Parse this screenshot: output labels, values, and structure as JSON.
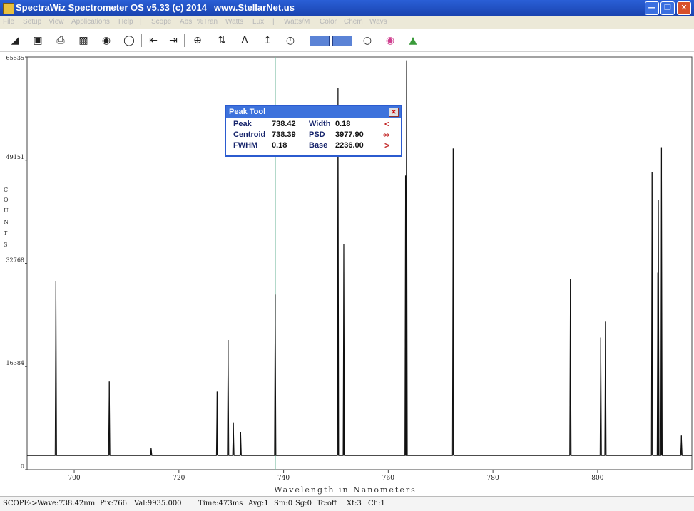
{
  "window": {
    "title": "SpectraWiz  Spectrometer OS v5.33 (c) 2014",
    "url": "www.StellarNet.us",
    "buttons": [
      "minimize-button",
      "restore-button",
      "close-button"
    ]
  },
  "menu": [
    "File",
    "Setup",
    "View",
    "Applications",
    "Help",
    "|",
    "Scope",
    "Abs",
    "%Tran",
    "Watts",
    "Lux",
    "|",
    "Watts/M",
    "Color",
    "Chem",
    "Wavs"
  ],
  "toolbar": {
    "icons": [
      "open-icon",
      "save-icon",
      "print-icon",
      "camera-icon",
      "bulb-dark-icon",
      "bulb-light-icon",
      "left-cursor-icon",
      "right-cursor-icon",
      "zoom-icon",
      "autoscale-y-icon",
      "peak-icon",
      "peak-up-icon",
      "timer-icon",
      "dark-store-icon",
      "reference-store-icon",
      "lamp-icon",
      "color-wheel-icon",
      "rgb-icon"
    ]
  },
  "peak_tool": {
    "title": "Peak Tool",
    "peak_label": "Peak",
    "peak": "738.42",
    "width_label": "Width",
    "width": "0.18",
    "centroid_label": "Centroid",
    "centroid": "738.39",
    "psd_label": "PSD",
    "psd": "3977.90",
    "fwhm_label": "FWHM",
    "fwhm": "0.18",
    "base_label": "Base",
    "base": "2236.00",
    "prev": "<",
    "mid": "∞",
    "next": ">"
  },
  "status": {
    "mode": "SCOPE->",
    "wave": "Wave:738.42nm",
    "pix": "Pix:766",
    "val": "Val:9935.000",
    "time": "Time:473ms",
    "avg": "Avg:1",
    "sm": "Sm:0",
    "sg": "Sg:0",
    "tc": "Tc:off",
    "xt": "Xt:3",
    "ch": "Ch:1"
  },
  "chart_data": {
    "type": "line",
    "title": "",
    "xlabel": "Wavelength in Nanometers",
    "ylabel": "COUNTS",
    "xlim": [
      691,
      818
    ],
    "ylim": [
      0,
      65535
    ],
    "x_ticks": [
      700,
      720,
      740,
      760,
      780,
      800
    ],
    "y_ticks": [
      0,
      16384,
      32768,
      49151,
      65535
    ],
    "cursor_x": 738.42,
    "baseline": 2236,
    "series": [
      {
        "peaks": [
          {
            "x": 696.5,
            "y": 30000
          },
          {
            "x": 706.7,
            "y": 14000
          },
          {
            "x": 714.7,
            "y": 3500
          },
          {
            "x": 727.3,
            "y": 12400
          },
          {
            "x": 729.4,
            "y": 20600
          },
          {
            "x": 730.4,
            "y": 7500
          },
          {
            "x": 731.8,
            "y": 6000
          },
          {
            "x": 738.4,
            "y": 27800
          },
          {
            "x": 750.4,
            "y": 60600
          },
          {
            "x": 751.5,
            "y": 35800
          },
          {
            "x": 763.5,
            "y": 65000
          },
          {
            "x": 763.3,
            "y": 46700
          },
          {
            "x": 772.4,
            "y": 51000
          },
          {
            "x": 794.8,
            "y": 30300
          },
          {
            "x": 800.6,
            "y": 21000
          },
          {
            "x": 801.5,
            "y": 23500
          },
          {
            "x": 810.4,
            "y": 47300
          },
          {
            "x": 811.5,
            "y": 31300
          },
          {
            "x": 812.2,
            "y": 51200
          },
          {
            "x": 811.6,
            "y": 42800
          },
          {
            "x": 816.0,
            "y": 5400
          }
        ]
      }
    ]
  }
}
